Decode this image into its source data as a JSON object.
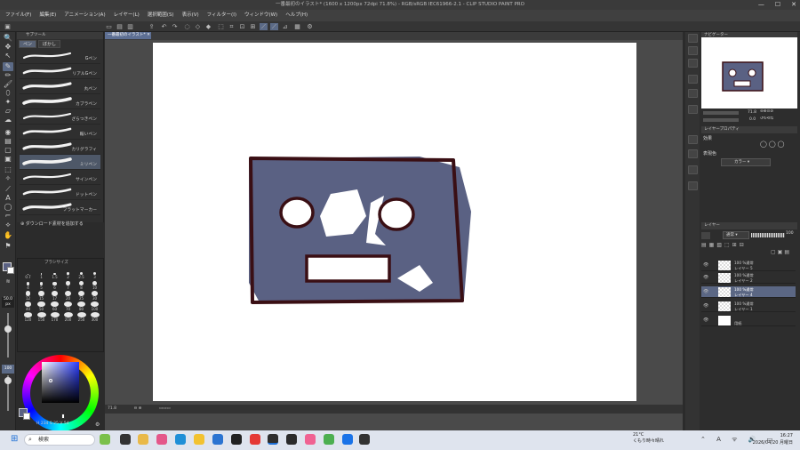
{
  "window": {
    "title": "一番最初のイラスト* (1600 x 1200px 72dpi 71.8%) - RGB/sRGB IEC61966-2.1 - CLIP STUDIO PAINT PRO",
    "minimize": "—",
    "maximize": "☐",
    "close": "✕"
  },
  "menu": [
    "ファイル(F)",
    "編集(E)",
    "アニメーション(A)",
    "レイヤー(L)",
    "選択範囲(S)",
    "表示(V)",
    "フィルター(I)",
    "ウィンドウ(W)",
    "ヘルプ(H)"
  ],
  "subtool": {
    "header": "サブツール",
    "tabs": [
      "ペン",
      "ぼかし"
    ],
    "brushes": [
      "Gペン",
      "リアルGペン",
      "丸ペン",
      "カブラペン",
      "ざらつきペン",
      "鞍いペン",
      "カリグラフィ",
      "ミリペン",
      "サインペン",
      "ドットペン",
      "フラットマーカー"
    ],
    "active_brush": "ミリペン",
    "add_material": "ダウンロード素材を追加する"
  },
  "brush_size": {
    "title": "ブラシサイズ",
    "values": [
      "0.7",
      "1",
      "1.5",
      "2",
      "2.5",
      "3",
      "4",
      "5",
      "6",
      "7",
      "8",
      "10",
      "12",
      "15",
      "17",
      "20",
      "25",
      "30",
      "40",
      "50",
      "60",
      "70",
      "80",
      "100",
      "120",
      "150",
      "170",
      "200",
      "250",
      "300"
    ],
    "current": "50.0",
    "unit": "px",
    "opacity": "100"
  },
  "color": {
    "readout_h": "234",
    "readout_s": "25",
    "readout_v": "54",
    "main_color": "#5a6183"
  },
  "document": {
    "tab_label": "一番最初のイラスト*",
    "zoom": "71.8"
  },
  "navigator": {
    "header": "ナビゲーター",
    "zoom": "71.8",
    "angle": "0.0"
  },
  "layer_property": {
    "header": "レイヤープロパティ",
    "effect_label": "効果",
    "display_color_label": "表現色",
    "display_color_value": "カラー"
  },
  "layers": {
    "header": "レイヤー",
    "blend_mode": "通常",
    "opacity": "100",
    "rows": [
      {
        "line1": "100 %通常",
        "line2": "レイヤー 5"
      },
      {
        "line1": "100 %通常",
        "line2": "レイヤー 2"
      },
      {
        "line1": "100 %通常",
        "line2": "レイヤー 4"
      },
      {
        "line1": "100 %通常",
        "line2": "レイヤー 1"
      },
      {
        "line1": "",
        "line2": "用紙"
      }
    ],
    "active_index": 2
  },
  "taskbar": {
    "search_placeholder": "検索",
    "weather_temp": "21°C",
    "weather_desc": "くもり時々晴れ",
    "time": "16:27",
    "date": "2026/04/20 月曜日"
  },
  "colors": {
    "accent": "#5b6a86",
    "fill": "#5a6183",
    "outline": "#3a0f14"
  }
}
